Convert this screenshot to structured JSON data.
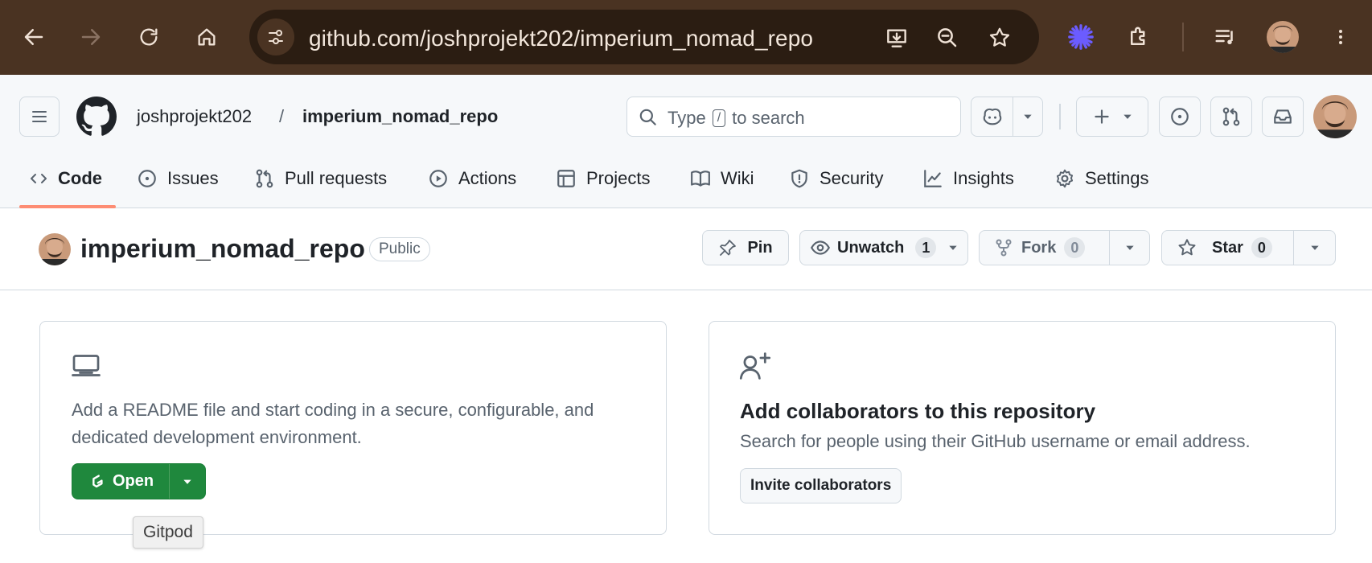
{
  "browser": {
    "url": "github.com/joshprojekt202/imperium_nomad_repo",
    "theme_color": "#4a3322"
  },
  "header": {
    "owner": "joshprojekt202",
    "separator": "/",
    "repo": "imperium_nomad_repo",
    "search": {
      "prefix": "Type",
      "key": "/",
      "suffix": "to search"
    }
  },
  "tabs": [
    {
      "label": "Code",
      "icon": "code-icon",
      "active": true
    },
    {
      "label": "Issues",
      "icon": "issue-opened-icon"
    },
    {
      "label": "Pull requests",
      "icon": "git-pull-request-icon"
    },
    {
      "label": "Actions",
      "icon": "play-icon"
    },
    {
      "label": "Projects",
      "icon": "table-icon"
    },
    {
      "label": "Wiki",
      "icon": "book-icon"
    },
    {
      "label": "Security",
      "icon": "shield-icon"
    },
    {
      "label": "Insights",
      "icon": "graph-icon"
    },
    {
      "label": "Settings",
      "icon": "gear-icon"
    }
  ],
  "repo_header": {
    "name": "imperium_nomad_repo",
    "visibility": "Public",
    "pin_label": "Pin",
    "unwatch_label": "Unwatch",
    "watch_count": "1",
    "fork_label": "Fork",
    "fork_count": "0",
    "star_label": "Star",
    "star_count": "0"
  },
  "codespace_card": {
    "text": "Add a README file and start coding in a secure, configurable, and dedicated development environment.",
    "open_label": "Open",
    "tooltip": "Gitpod"
  },
  "collab_card": {
    "title": "Add collaborators to this repository",
    "text": "Search for people using their GitHub username or email address.",
    "invite_label": "Invite collaborators"
  },
  "colors": {
    "accent_underline": "#fd8c73",
    "primary_button": "#1f883d"
  }
}
